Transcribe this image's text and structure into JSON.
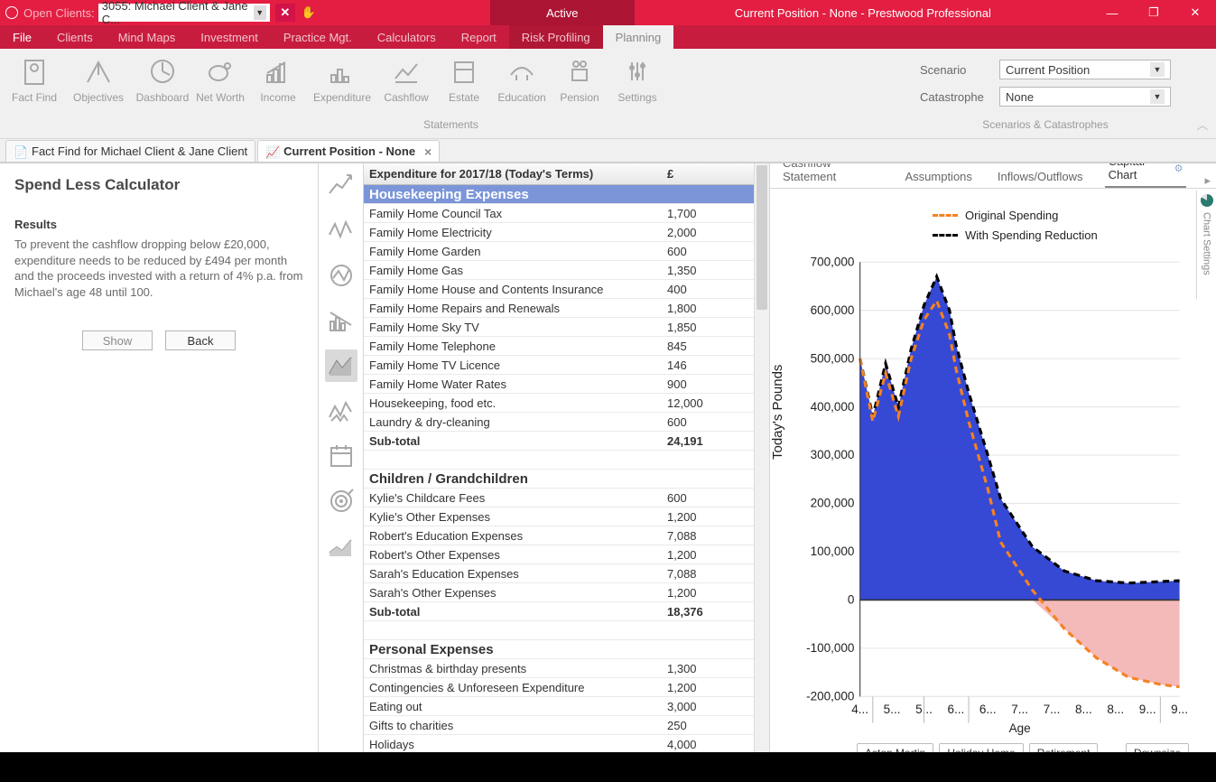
{
  "titlebar": {
    "open_clients_label": "Open Clients:",
    "open_clients_value": "3055: Michael Client & Jane C...",
    "active_label": "Active",
    "window_title": "Current Position - None - Prestwood Professional"
  },
  "menu": {
    "file": "File",
    "clients": "Clients",
    "mindmaps": "Mind Maps",
    "investment": "Investment",
    "practice": "Practice Mgt.",
    "calculators": "Calculators",
    "report": "Report",
    "risk": "Risk Profiling",
    "planning": "Planning"
  },
  "ribbon": {
    "items": [
      "Fact Find",
      "Objectives",
      "Dashboard",
      "Net Worth",
      "Income",
      "Expenditure",
      "Cashflow",
      "Estate",
      "Education",
      "Pension",
      "Settings"
    ],
    "group1_label": "Statements",
    "scenario_label": "Scenario",
    "scenario_value": "Current Position",
    "catastrophe_label": "Catastrophe",
    "catastrophe_value": "None",
    "group2_label": "Scenarios & Catastrophes"
  },
  "doctabs": {
    "tab1": "Fact Find for Michael Client & Jane Client",
    "tab2": "Current Position - None"
  },
  "left": {
    "title": "Spend Less Calculator",
    "results_label": "Results",
    "results_text": "To prevent the cashflow dropping below £20,000, expenditure needs to be reduced by £494 per month and the proceeds invested with a return of 4% p.a. from Michael's age 48 until 100.",
    "show": "Show",
    "back": "Back"
  },
  "table": {
    "header_label": "Expenditure for 2017/18 (Today's Terms)",
    "header_amount": "£",
    "rows": [
      {
        "type": "hl",
        "label": "Housekeeping Expenses",
        "amount": ""
      },
      {
        "type": "",
        "label": "Family Home Council Tax",
        "amount": "1,700"
      },
      {
        "type": "",
        "label": "Family Home Electricity",
        "amount": "2,000"
      },
      {
        "type": "",
        "label": "Family Home Garden",
        "amount": "600"
      },
      {
        "type": "",
        "label": "Family Home Gas",
        "amount": "1,350"
      },
      {
        "type": "",
        "label": "Family Home House and Contents Insurance",
        "amount": "400"
      },
      {
        "type": "",
        "label": "Family Home Repairs and Renewals",
        "amount": "1,800"
      },
      {
        "type": "",
        "label": "Family Home Sky TV",
        "amount": "1,850"
      },
      {
        "type": "",
        "label": "Family Home Telephone",
        "amount": "845"
      },
      {
        "type": "",
        "label": "Family Home TV Licence",
        "amount": "146"
      },
      {
        "type": "",
        "label": "Family Home Water Rates",
        "amount": "900"
      },
      {
        "type": "",
        "label": "Housekeeping, food etc.",
        "amount": "12,000"
      },
      {
        "type": "",
        "label": "Laundry & dry-cleaning",
        "amount": "600"
      },
      {
        "type": "sub",
        "label": "Sub-total",
        "amount": "24,191"
      },
      {
        "type": "blank",
        "label": "",
        "amount": ""
      },
      {
        "type": "section",
        "label": "Children / Grandchildren",
        "amount": ""
      },
      {
        "type": "",
        "label": "Kylie's Childcare Fees",
        "amount": "600"
      },
      {
        "type": "",
        "label": "Kylie's Other Expenses",
        "amount": "1,200"
      },
      {
        "type": "",
        "label": "Robert's Education Expenses",
        "amount": "7,088"
      },
      {
        "type": "",
        "label": "Robert's Other Expenses",
        "amount": "1,200"
      },
      {
        "type": "",
        "label": "Sarah's Education Expenses",
        "amount": "7,088"
      },
      {
        "type": "",
        "label": "Sarah's Other Expenses",
        "amount": "1,200"
      },
      {
        "type": "sub",
        "label": "Sub-total",
        "amount": "18,376"
      },
      {
        "type": "blank",
        "label": "",
        "amount": ""
      },
      {
        "type": "section",
        "label": "Personal Expenses",
        "amount": ""
      },
      {
        "type": "",
        "label": "Christmas & birthday presents",
        "amount": "1,300"
      },
      {
        "type": "",
        "label": "Contingencies & Unforeseen Expenditure",
        "amount": "1,200"
      },
      {
        "type": "",
        "label": "Eating out",
        "amount": "3,000"
      },
      {
        "type": "",
        "label": "Gifts to charities",
        "amount": "250"
      },
      {
        "type": "",
        "label": "Holidays",
        "amount": "4,000"
      }
    ]
  },
  "right": {
    "tabs": [
      "Cashflow Statement",
      "Assumptions",
      "Inflows/Outflows",
      "Capital Chart"
    ],
    "side_label": "Chart Settings",
    "legend": {
      "orig": "Original Spending",
      "red": "With Spending Reduction"
    },
    "ylabel": "Today's Pounds",
    "xlabel": "Age",
    "annotations": [
      "Aston Martin",
      "Holiday Home",
      "Retirement",
      "Downsize"
    ]
  },
  "chart_data": {
    "type": "line",
    "xlabel": "Age",
    "ylabel": "Today's Pounds",
    "ylim": [
      -200000,
      700000
    ],
    "x_ticks": [
      "4...",
      "5...",
      "5...",
      "6...",
      "6...",
      "7...",
      "7...",
      "8...",
      "8...",
      "9...",
      "9..."
    ],
    "y_ticks": [
      -200000,
      -100000,
      0,
      100000,
      200000,
      300000,
      400000,
      500000,
      600000,
      700000
    ],
    "x": [
      48,
      50,
      52,
      54,
      55,
      56,
      58,
      60,
      62,
      63,
      65,
      68,
      70,
      75,
      80,
      85,
      90,
      95,
      98
    ],
    "series": [
      {
        "name": "Original Spending",
        "style": "dashed",
        "color": "#f58220",
        "values": [
          500000,
          370000,
          470000,
          380000,
          440000,
          500000,
          580000,
          620000,
          550000,
          480000,
          370000,
          230000,
          120000,
          20000,
          -60000,
          -120000,
          -160000,
          -175000,
          -180000
        ]
      },
      {
        "name": "With Spending Reduction",
        "style": "dashed",
        "color": "#000000",
        "values": [
          500000,
          380000,
          490000,
          400000,
          460000,
          520000,
          610000,
          670000,
          600000,
          530000,
          430000,
          300000,
          210000,
          110000,
          60000,
          40000,
          35000,
          38000,
          40000
        ]
      }
    ],
    "fill_positive_color": "#2b3fd2",
    "fill_negative_color": "#f4b9b9",
    "annotations": [
      {
        "label": "Aston Martin",
        "x": 50
      },
      {
        "label": "Holiday Home",
        "x": 58
      },
      {
        "label": "Retirement",
        "x": 65
      },
      {
        "label": "Downsize",
        "x": 95
      }
    ]
  }
}
